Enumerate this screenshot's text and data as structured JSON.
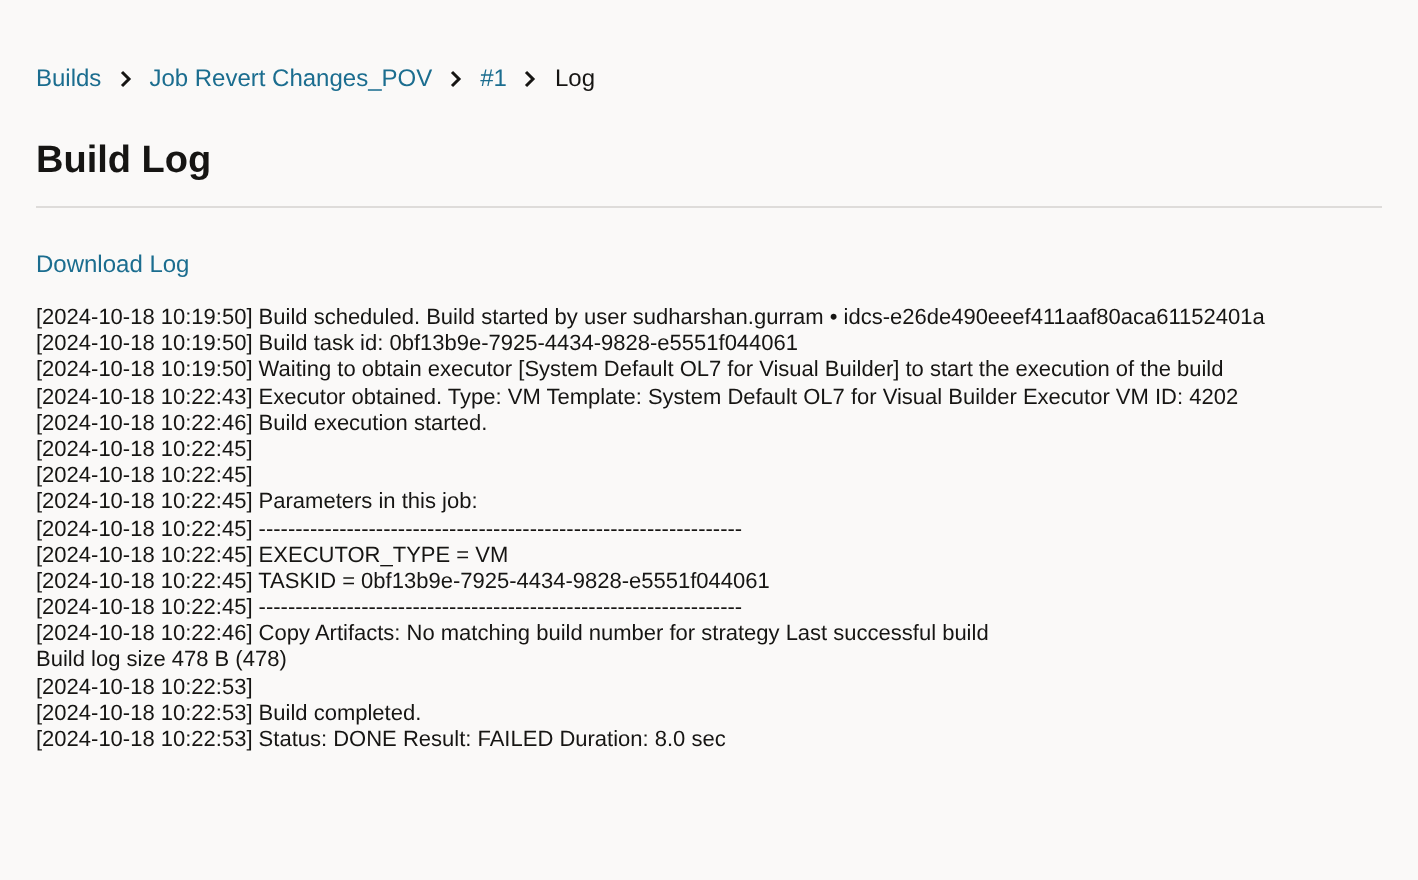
{
  "breadcrumbs": [
    {
      "label": "Builds",
      "current": false
    },
    {
      "label": "Job Revert Changes_POV",
      "current": false
    },
    {
      "label": "#1",
      "current": false
    },
    {
      "label": "Log",
      "current": true
    }
  ],
  "heading": "Build Log",
  "download_link": "Download Log",
  "log_lines": [
    "[2024-10-18 10:19:50] Build scheduled. Build started by user sudharshan.gurram • idcs-e26de490eeef411aaf80aca61152401a",
    "[2024-10-18 10:19:50] Build task id: 0bf13b9e-7925-4434-9828-e5551f044061",
    "[2024-10-18 10:19:50] Waiting to obtain executor [System Default OL7 for Visual Builder] to start the execution of the build",
    "[2024-10-18 10:22:43] Executor obtained. Type: VM Template: System Default OL7 for Visual Builder Executor VM ID: 4202",
    "[2024-10-18 10:22:46] Build execution started.",
    "[2024-10-18 10:22:45]",
    "[2024-10-18 10:22:45]",
    "[2024-10-18 10:22:45] Parameters in this job:",
    "[2024-10-18 10:22:45] ------------------------------------------------------------------",
    "[2024-10-18 10:22:45] EXECUTOR_TYPE = VM",
    "[2024-10-18 10:22:45] TASKID = 0bf13b9e-7925-4434-9828-e5551f044061",
    "[2024-10-18 10:22:45] ------------------------------------------------------------------",
    "[2024-10-18 10:22:46] Copy Artifacts: No matching build number for strategy Last successful build",
    "Build log size 478 B (478)",
    "[2024-10-18 10:22:53]",
    "[2024-10-18 10:22:53] Build completed.",
    "[2024-10-18 10:22:53] Status: DONE Result: FAILED Duration: 8.0 sec"
  ]
}
